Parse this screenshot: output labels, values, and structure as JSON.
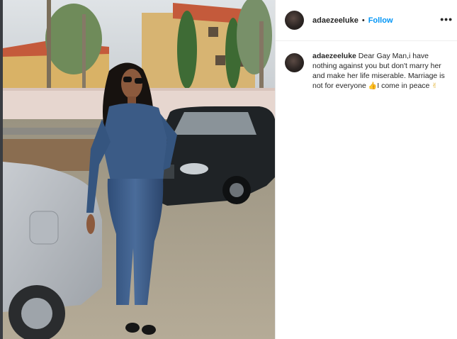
{
  "post": {
    "username": "adaezeeluke",
    "separator": "•",
    "follow_label": "Follow",
    "more_label": "•••"
  },
  "caption": {
    "username": "adaezeeluke",
    "text_part1": "Dear Gay Man,i have nothing against you but don't marry her and make her life miserable. Marriage is not for everyone ",
    "emoji1": "👍",
    "text_part2": "I come in peace ",
    "emoji2": "✌"
  },
  "icons": {
    "avatar": "avatar",
    "more": "more-options-icon",
    "emoji1": "thumbs-up-icon",
    "emoji2": "victory-hand-icon"
  },
  "colors": {
    "follow": "#0095f6",
    "text": "#262626",
    "divider": "#efefef"
  }
}
